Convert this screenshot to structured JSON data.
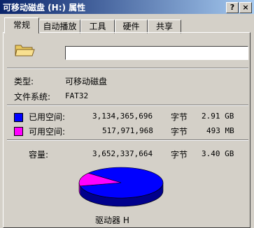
{
  "window": {
    "title": "可移动磁盘 (H:) 属性",
    "help_label": "?",
    "close_label": "×"
  },
  "tabs": [
    "常规",
    "自动播放",
    "工具",
    "硬件",
    "共享"
  ],
  "general": {
    "name_value": "",
    "type_label": "类型:",
    "type_value": "可移动磁盘",
    "fs_label": "文件系统:",
    "fs_value": "FAT32"
  },
  "usage": {
    "used": {
      "label": "已用空间:",
      "bytes": "3,134,365,696",
      "unit": "字节",
      "size": "2.91 GB",
      "color": "#0000ff"
    },
    "free": {
      "label": "可用空间:",
      "bytes": "517,971,968",
      "unit": "字节",
      "size": "493 MB",
      "color": "#ff00ff"
    },
    "capacity": {
      "label": "容量:",
      "bytes": "3,652,337,664",
      "unit": "字节",
      "size": "3.40 GB"
    }
  },
  "drive_label": "驱动器 H",
  "chart_data": {
    "type": "pie",
    "labels": [
      "已用空间",
      "可用空间"
    ],
    "values": [
      3134365696,
      517971968
    ],
    "colors": [
      "#0000ff",
      "#ff00ff"
    ]
  }
}
